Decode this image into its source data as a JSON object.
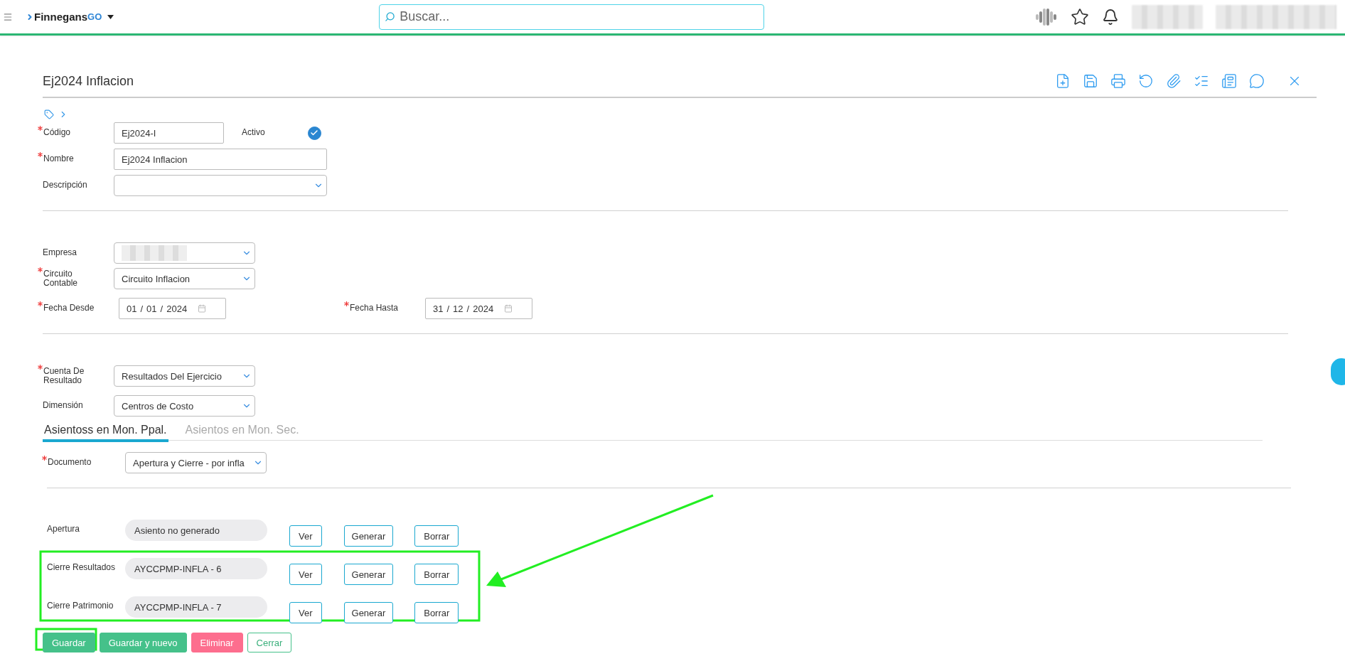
{
  "header": {
    "logo": "Finnegans",
    "logo_suffix": "GO",
    "search_placeholder": "Buscar..."
  },
  "title": "Ej2024 Inflacion",
  "general": [
    {
      "kind": "text",
      "label": "Código",
      "required": true,
      "value": "Ej2024-I",
      "side": {
        "label": "Activo",
        "checked": true
      }
    },
    {
      "kind": "text",
      "label": "Nombre",
      "required": true,
      "value": "Ej2024 Inflacion"
    },
    {
      "kind": "select",
      "label": "Descripción",
      "required": false
    }
  ],
  "empresa_section": [
    {
      "kind": "select",
      "label": "Empresa",
      "required": false,
      "hidden_value": true
    },
    {
      "kind": "select",
      "label": "Circuito Contable",
      "required": true,
      "value": "Circuito Inflacion"
    }
  ],
  "dates": [
    {
      "label": "Fecha Desde",
      "required": true,
      "day": "01",
      "month": "01",
      "year": "2024",
      "separator": "/"
    },
    {
      "label": "Fecha Hasta",
      "required": true,
      "day": "31",
      "month": "12",
      "year": "2024",
      "separator": "/"
    }
  ],
  "cuenta_section": [
    {
      "kind": "select",
      "label": "Cuenta De Resultado",
      "required": true,
      "value": "Resultados Del Ejercicio"
    },
    {
      "kind": "select",
      "label": "Dimensión",
      "required": false,
      "value": "Centros de Costo"
    }
  ],
  "tabs": [
    {
      "label": "Asientoss en Mon. Ppal.",
      "selected": true
    },
    {
      "label": "Asientos en Mon. Sec.",
      "selected": false
    }
  ],
  "documento": {
    "label": "Documento",
    "required": true,
    "value": "Apertura y Cierre - por infla"
  },
  "asientos": [
    {
      "label": "Apertura",
      "value": "Asiento no generado",
      "buttons": [
        "Ver",
        "Generar",
        "Borrar"
      ]
    },
    {
      "label": "Cierre Resultados",
      "value": "AYCCPMP-INFLA - 6",
      "buttons": [
        "Ver",
        "Generar",
        "Borrar"
      ]
    },
    {
      "label": "Cierre Patrimonio",
      "value": "AYCCPMP-INFLA - 7",
      "buttons": [
        "Ver",
        "Generar",
        "Borrar"
      ]
    }
  ],
  "footer_buttons": [
    {
      "label": "Guardar",
      "kind": "primary"
    },
    {
      "label": "Guardar y nuevo",
      "kind": "primary"
    },
    {
      "label": "Eliminar",
      "kind": "danger"
    },
    {
      "label": "Cerrar",
      "kind": "outline"
    }
  ]
}
